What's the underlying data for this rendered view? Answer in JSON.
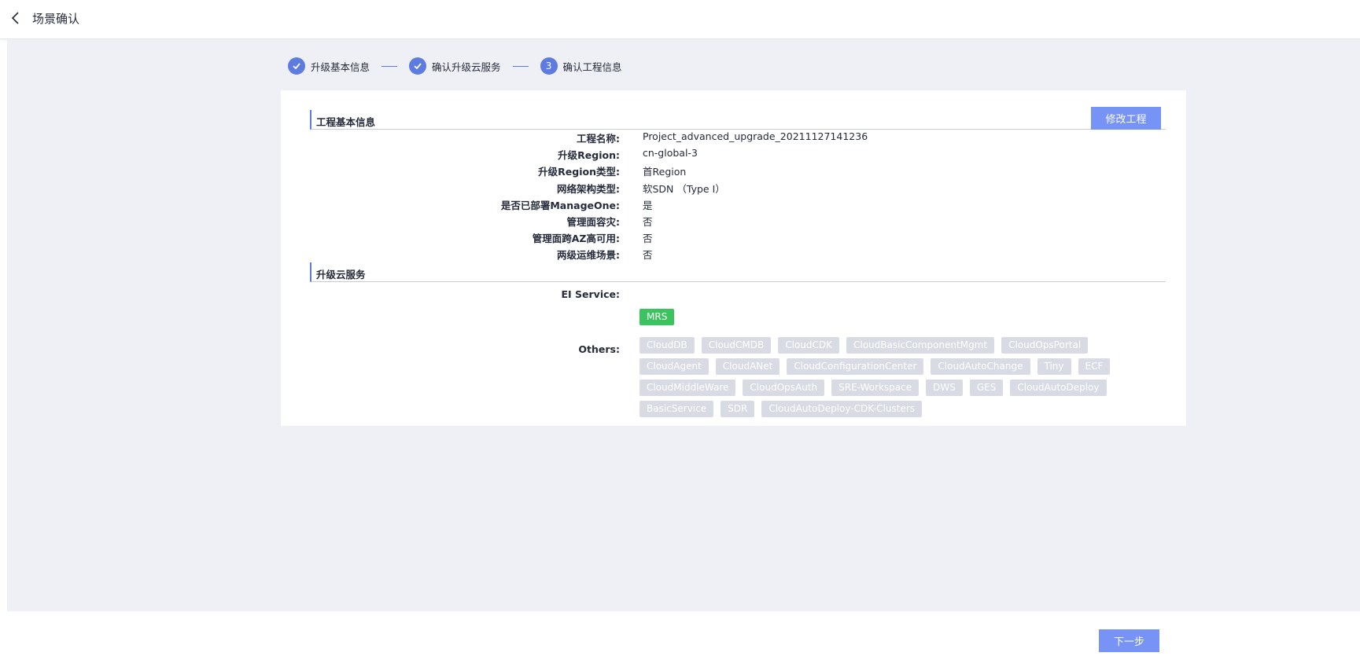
{
  "header": {
    "title": "场景确认"
  },
  "steps": [
    {
      "label": "升级基本信息",
      "status": "done"
    },
    {
      "label": "确认升级云服务",
      "status": "done"
    },
    {
      "label": "确认工程信息",
      "number": "3",
      "status": "current"
    }
  ],
  "basic_info": {
    "title": "工程基本信息",
    "edit_button": "修改工程",
    "rows": [
      {
        "label": "工程名称:",
        "value": "Project_advanced_upgrade_20211127141236"
      },
      {
        "label": "升级Region:",
        "value": "cn-global-3"
      },
      {
        "label": "升级Region类型:",
        "value": "首Region"
      },
      {
        "label": "网络架构类型:",
        "value": "软SDN （Type I）"
      },
      {
        "label": "是否已部署ManageOne:",
        "value": "是"
      },
      {
        "label": "管理面容灾:",
        "value": "否"
      },
      {
        "label": "管理面跨AZ高可用:",
        "value": "否"
      },
      {
        "label": "两级运维场景:",
        "value": "否"
      }
    ]
  },
  "services": {
    "title": "升级云服务",
    "ei_label": "EI Service:",
    "ei_tags": [
      "MRS"
    ],
    "others_label": "Others:",
    "others_tags": [
      "CloudDB",
      "CloudCMDB",
      "CloudCDK",
      "CloudBasicComponentMgmt",
      "CloudOpsPortal",
      "CloudAgent",
      "CloudANet",
      "CloudConfigurationCenter",
      "CloudAutoChange",
      "Tiny",
      "ECF",
      "CloudMiddleWare",
      "CloudOpsAuth",
      "SRE-Workspace",
      "DWS",
      "GES",
      "CloudAutoDeploy",
      "BasicService",
      "SDR",
      "CloudAutoDeploy-CDK-Clusters"
    ]
  },
  "footer": {
    "next_button": "下一步"
  },
  "colors": {
    "primary": "#5e7ce0",
    "button": "#7693f5",
    "success": "#3ac35f",
    "tag_disabled": "#d8dbe4",
    "background": "#eef0f5"
  }
}
